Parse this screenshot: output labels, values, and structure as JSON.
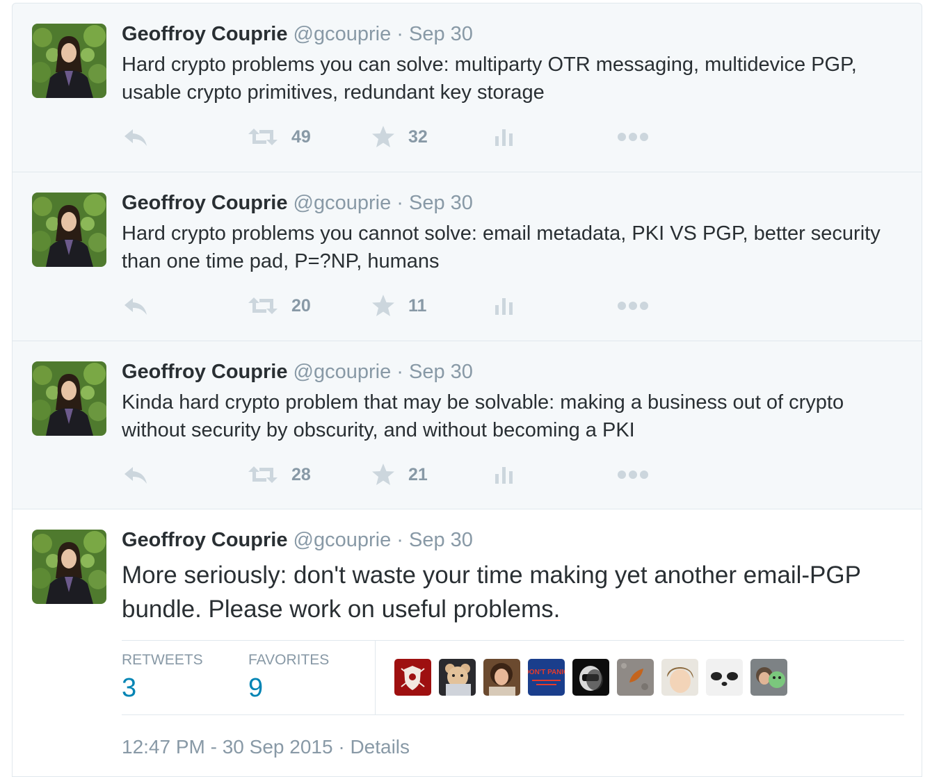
{
  "tweets": [
    {
      "name": "Geoffroy Couprie",
      "handle": "@gcouprie",
      "sep": "·",
      "date": "Sep 30",
      "text": "Hard crypto problems you can solve: multiparty OTR messaging, multidevice PGP, usable crypto primitives, redundant key storage",
      "retweets": "49",
      "favorites": "32"
    },
    {
      "name": "Geoffroy Couprie",
      "handle": "@gcouprie",
      "sep": "·",
      "date": "Sep 30",
      "text": "Hard crypto problems you cannot solve: email metadata, PKI VS PGP, better security than one time pad, P=?NP, humans",
      "retweets": "20",
      "favorites": "11"
    },
    {
      "name": "Geoffroy Couprie",
      "handle": "@gcouprie",
      "sep": "·",
      "date": "Sep 30",
      "text": "Kinda hard crypto problem that may be solvable: making a business out of crypto without security by obscurity, and without becoming a PKI",
      "retweets": "28",
      "favorites": "21"
    }
  ],
  "main_tweet": {
    "name": "Geoffroy Couprie",
    "handle": "@gcouprie",
    "sep": "·",
    "date": "Sep 30",
    "text": "More seriously: don't waste your time making yet another email-PGP bundle. Please work on useful problems.",
    "retweets_label": "RETWEETS",
    "retweets": "3",
    "favorites_label": "FAVORITES",
    "favorites": "9",
    "timestamp": "12:47 PM - 30 Sep 2015",
    "footer_sep": "·",
    "details": "Details",
    "favoriter_avatars": [
      "shield-avatar",
      "teddy-bear-avatar",
      "woman-avatar",
      "dont-panic-avatar",
      "daft-punk-helmet-avatar",
      "leaf-avatar",
      "blonde-person-avatar",
      "panda-avatar",
      "plush-toy-avatar"
    ],
    "dont_panic_text": "DON'T PANIC"
  },
  "colors": {
    "link": "#0084b4",
    "muted": "#8899a6",
    "text": "#292f33",
    "action_icon": "#ccd6dd",
    "border": "#e1e8ed"
  }
}
